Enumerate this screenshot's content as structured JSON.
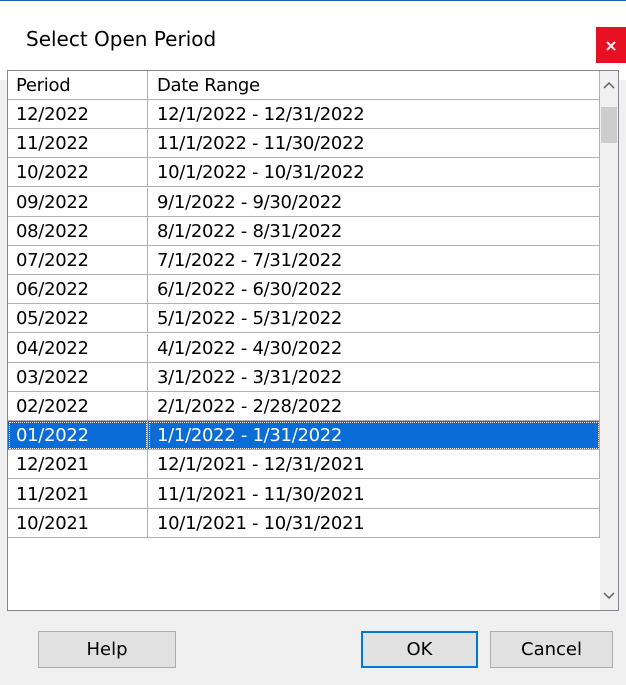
{
  "dialog": {
    "title": "Select Open Period",
    "close_label": "×"
  },
  "list": {
    "columns": [
      "Period",
      "Date Range"
    ],
    "rows": [
      {
        "period": "12/2022",
        "range": "12/1/2022 - 12/31/2022",
        "selected": false
      },
      {
        "period": "11/2022",
        "range": "11/1/2022 - 11/30/2022",
        "selected": false
      },
      {
        "period": "10/2022",
        "range": "10/1/2022 - 10/31/2022",
        "selected": false
      },
      {
        "period": "09/2022",
        "range": "9/1/2022 - 9/30/2022",
        "selected": false
      },
      {
        "period": "08/2022",
        "range": "8/1/2022 - 8/31/2022",
        "selected": false
      },
      {
        "period": "07/2022",
        "range": "7/1/2022 - 7/31/2022",
        "selected": false
      },
      {
        "period": "06/2022",
        "range": "6/1/2022 - 6/30/2022",
        "selected": false
      },
      {
        "period": "05/2022",
        "range": "5/1/2022 - 5/31/2022",
        "selected": false
      },
      {
        "period": "04/2022",
        "range": "4/1/2022 - 4/30/2022",
        "selected": false
      },
      {
        "period": "03/2022",
        "range": "3/1/2022 - 3/31/2022",
        "selected": false
      },
      {
        "period": "02/2022",
        "range": "2/1/2022 - 2/28/2022",
        "selected": false
      },
      {
        "period": "01/2022",
        "range": "1/1/2022 - 1/31/2022",
        "selected": true
      },
      {
        "period": "12/2021",
        "range": "12/1/2021 - 12/31/2021",
        "selected": false
      },
      {
        "period": "11/2021",
        "range": "11/1/2021 - 11/30/2021",
        "selected": false
      },
      {
        "period": "10/2021",
        "range": "10/1/2021 - 10/31/2021",
        "selected": false
      }
    ]
  },
  "buttons": {
    "help": "Help",
    "ok": "OK",
    "cancel": "Cancel"
  },
  "icons": {
    "scroll_up": "chevron-up-icon",
    "scroll_down": "chevron-down-icon",
    "close": "close-icon"
  },
  "colors": {
    "selection": "#0a6cd6",
    "close_button": "#e81123",
    "default_button_border": "#0078d7"
  }
}
